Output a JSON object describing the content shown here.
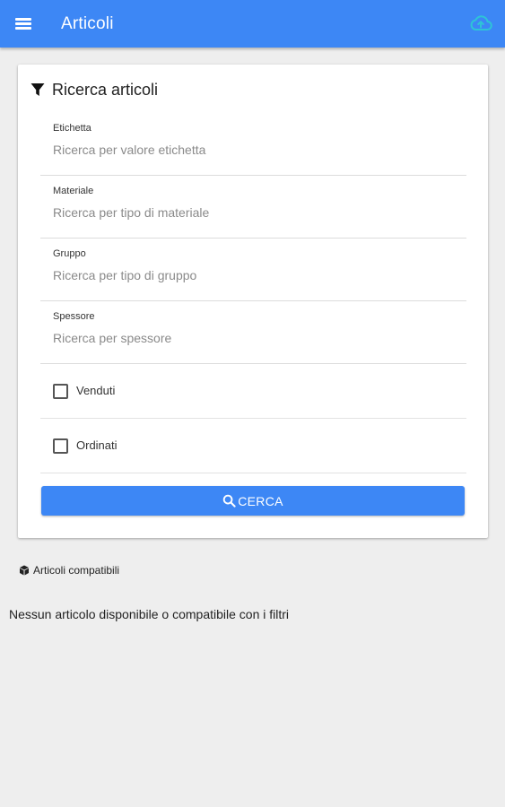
{
  "appbar": {
    "title": "Articoli",
    "menu_icon": "menu-icon",
    "cloud_icon": "cloud-upload-icon",
    "bar_color": "#3d87f5",
    "cloud_color": "#2ec4d6"
  },
  "search_card": {
    "title": "Ricerca articoli",
    "title_icon": "filter-icon",
    "fields": [
      {
        "label": "Etichetta",
        "placeholder": "Ricerca per valore etichetta",
        "value": ""
      },
      {
        "label": "Materiale",
        "placeholder": "Ricerca per tipo di materiale",
        "value": ""
      },
      {
        "label": "Gruppo",
        "placeholder": "Ricerca per tipo di gruppo",
        "value": ""
      },
      {
        "label": "Spessore",
        "placeholder": "Ricerca per spessore",
        "value": ""
      }
    ],
    "checkboxes": [
      {
        "label": "Venduti",
        "checked": false
      },
      {
        "label": "Ordinati",
        "checked": false
      }
    ],
    "search_button": {
      "label": "CERCA",
      "icon": "search-icon"
    }
  },
  "results": {
    "section_label": "Articoli compatibili",
    "section_icon": "cube-icon",
    "empty_message": "Nessun articolo disponibile o compatibile con i filtri"
  }
}
